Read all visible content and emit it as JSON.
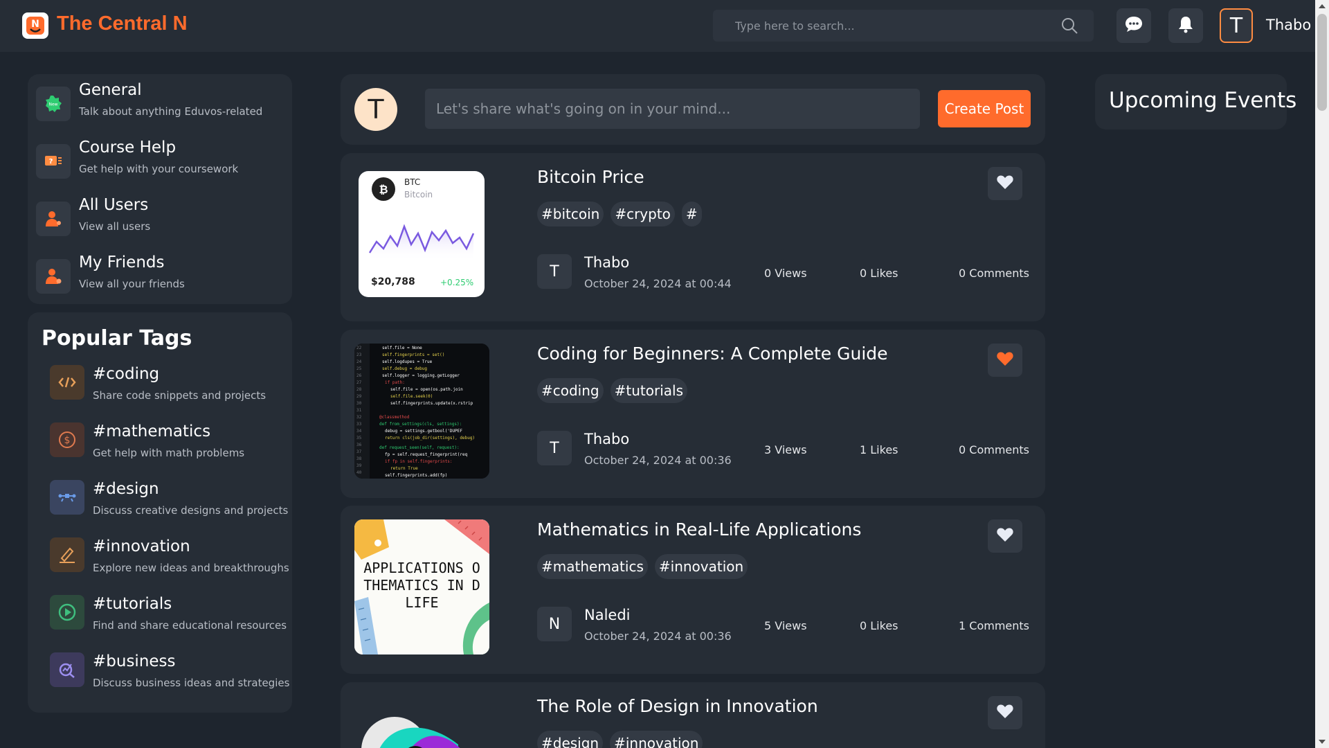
{
  "header": {
    "brand": "The Central N",
    "search_placeholder": "Type here to search...",
    "user_initial": "T",
    "user_name": "Thabo"
  },
  "sidebar": {
    "nav": [
      {
        "title": "General",
        "subtitle": "Talk about anything Eduvos-related",
        "icon": "new-badge-icon"
      },
      {
        "title": "Course Help",
        "subtitle": "Get help with your coursework",
        "icon": "help-ticket-icon"
      },
      {
        "title": "All Users",
        "subtitle": "View all users",
        "icon": "users-icon"
      },
      {
        "title": "My Friends",
        "subtitle": "View all your friends",
        "icon": "friends-icon"
      }
    ],
    "tags_heading": "Popular Tags",
    "tags": [
      {
        "title": "#coding",
        "subtitle": "Share code snippets and projects",
        "icon": "code-icon",
        "color": "#d98a3c"
      },
      {
        "title": "#mathematics",
        "subtitle": "Get help with math problems",
        "icon": "dollar-circle-icon",
        "color": "#e07a4f"
      },
      {
        "title": "#design",
        "subtitle": "Discuss creative designs and projects",
        "icon": "design-tool-icon",
        "color": "#5a8fd8"
      },
      {
        "title": "#innovation",
        "subtitle": "Explore new ideas and breakthroughs",
        "icon": "pen-icon",
        "color": "#d98a3c"
      },
      {
        "title": "#tutorials",
        "subtitle": "Find and share educational resources",
        "icon": "play-circle-icon",
        "color": "#3fbf7f"
      },
      {
        "title": "#business",
        "subtitle": "Discuss business ideas and strategies",
        "icon": "chart-search-icon",
        "color": "#8f7fe0"
      }
    ]
  },
  "composer": {
    "avatar_initial": "T",
    "placeholder": "Let's share what's going on in your mind...",
    "button": "Create Post"
  },
  "posts": [
    {
      "title": "Bitcoin Price",
      "tags": [
        "#bitcoin",
        "#crypto",
        "#"
      ],
      "author_initial": "T",
      "author": "Thabo",
      "date": "October 24, 2024 at 00:44",
      "views": "0 Views",
      "likes": "0 Likes",
      "comments": "0 Comments",
      "liked": false,
      "thumb": {
        "symbol": "BTC",
        "name": "Bitcoin",
        "price": "$20,788",
        "change": "+0.25%"
      }
    },
    {
      "title": "Coding for Beginners: A Complete Guide",
      "tags": [
        "#coding",
        "#tutorials"
      ],
      "author_initial": "T",
      "author": "Thabo",
      "date": "October 24, 2024 at 00:36",
      "views": "3 Views",
      "likes": "1 Likes",
      "comments": "0 Comments",
      "liked": true
    },
    {
      "title": "Mathematics in Real-Life Applications",
      "tags": [
        "#mathematics",
        "#innovation"
      ],
      "author_initial": "N",
      "author": "Naledi",
      "date": "October 24, 2024 at 00:36",
      "views": "5 Views",
      "likes": "0 Likes",
      "comments": "1 Comments",
      "liked": false,
      "thumb": {
        "line1": "APPLICATIONS O",
        "line2": "THEMATICS IN D",
        "line3": "LIFE"
      }
    },
    {
      "title": "The Role of Design in Innovation",
      "tags": [
        "#design",
        "#innovation"
      ],
      "liked": false
    }
  ],
  "events": {
    "title": "Upcoming Events"
  },
  "colors": {
    "accent": "#ff6b2c",
    "background": "#1e252e",
    "panel": "#262d36",
    "liked_heart": "#ff6b2c",
    "heart": "#e8ecf5"
  }
}
